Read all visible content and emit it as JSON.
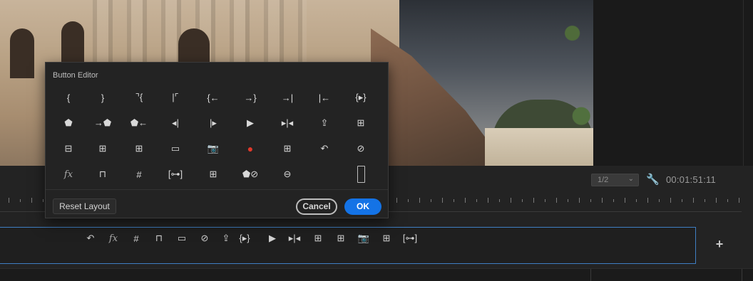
{
  "dialog": {
    "title": "Button Editor",
    "reset_label": "Reset Layout",
    "cancel_label": "Cancel",
    "ok_label": "OK",
    "accent_color": "#1473e6",
    "buttons": [
      {
        "name": "mark-in-icon",
        "glyph": "{"
      },
      {
        "name": "mark-out-icon",
        "glyph": "}"
      },
      {
        "name": "clear-in-icon",
        "glyph": "⌝{"
      },
      {
        "name": "clear-out-icon",
        "glyph": "|⌜"
      },
      {
        "name": "go-to-in-icon",
        "glyph": "{←"
      },
      {
        "name": "go-to-out-icon",
        "glyph": "→}"
      },
      {
        "name": "go-to-next-edit-icon",
        "glyph": "→|"
      },
      {
        "name": "go-to-previous-edit-icon",
        "glyph": "|←"
      },
      {
        "name": "play-in-to-out-icon",
        "glyph": "{▸}"
      },
      {
        "name": "add-marker-icon",
        "glyph": "⬟"
      },
      {
        "name": "go-to-next-marker-icon",
        "glyph": "→⬟"
      },
      {
        "name": "go-to-previous-marker-icon",
        "glyph": "⬟←"
      },
      {
        "name": "step-back-icon",
        "glyph": "◂|"
      },
      {
        "name": "step-forward-icon",
        "glyph": "|▸"
      },
      {
        "name": "play-stop-icon",
        "glyph": "▶"
      },
      {
        "name": "play-around-icon",
        "glyph": "▸|◂"
      },
      {
        "name": "export-to-timeline-icon",
        "glyph": "⇪"
      },
      {
        "name": "insert-icon",
        "glyph": "⊞"
      },
      {
        "name": "lift-icon",
        "glyph": "⊟"
      },
      {
        "name": "extract-icon",
        "glyph": "⊞"
      },
      {
        "name": "overwrite-icon",
        "glyph": "⊞"
      },
      {
        "name": "safe-margins-icon",
        "glyph": "▭"
      },
      {
        "name": "export-frame-icon",
        "glyph": "📷"
      },
      {
        "name": "record-icon",
        "glyph": "●"
      },
      {
        "name": "multi-camera-icon",
        "glyph": "⊞"
      },
      {
        "name": "loop-icon",
        "glyph": "↶"
      },
      {
        "name": "comparison-view-icon",
        "glyph": "⊘"
      },
      {
        "name": "toggle-effects-icon",
        "glyph": "fx"
      },
      {
        "name": "show-rulers-icon",
        "glyph": "⊓"
      },
      {
        "name": "show-guides-icon",
        "glyph": "#"
      },
      {
        "name": "snap-in-program-monitor-icon",
        "glyph": "[⊶]"
      },
      {
        "name": "toggle-proxies-icon",
        "glyph": "⊞"
      },
      {
        "name": "vr-video-icon",
        "glyph": "⬟⊘"
      },
      {
        "name": "global-fx-mute-icon",
        "glyph": "⊖"
      },
      {
        "name": "empty-slot",
        "glyph": ""
      },
      {
        "name": "spacer-icon",
        "glyph": ""
      }
    ]
  },
  "monitor": {
    "resolution": "1/2",
    "timecode": "00:01:51:11",
    "selection_color": "#3f7fc4",
    "button_bar": [
      {
        "name": "loop-icon",
        "glyph": "↶"
      },
      {
        "name": "toggle-effects-icon",
        "glyph": "fx"
      },
      {
        "name": "show-guides-icon",
        "glyph": "#"
      },
      {
        "name": "show-rulers-icon",
        "glyph": "⊓"
      },
      {
        "name": "safe-margins-icon",
        "glyph": "▭"
      },
      {
        "name": "comparison-view-icon",
        "glyph": "⊘"
      },
      {
        "name": "export-to-timeline-icon",
        "glyph": "⇪"
      },
      {
        "name": "play-in-to-out-icon",
        "glyph": "{▸}"
      },
      {
        "name": "play-stop-icon",
        "glyph": "▶"
      },
      {
        "name": "play-around-icon",
        "glyph": "▸|◂"
      },
      {
        "name": "insert-icon",
        "glyph": "⊞"
      },
      {
        "name": "overwrite-icon",
        "glyph": "⊞"
      },
      {
        "name": "export-frame-icon",
        "glyph": "📷"
      },
      {
        "name": "toggle-proxies-icon",
        "glyph": "⊞"
      },
      {
        "name": "snap-in-program-monitor-icon",
        "glyph": "[⊶]"
      }
    ],
    "add_button_glyph": "+"
  }
}
